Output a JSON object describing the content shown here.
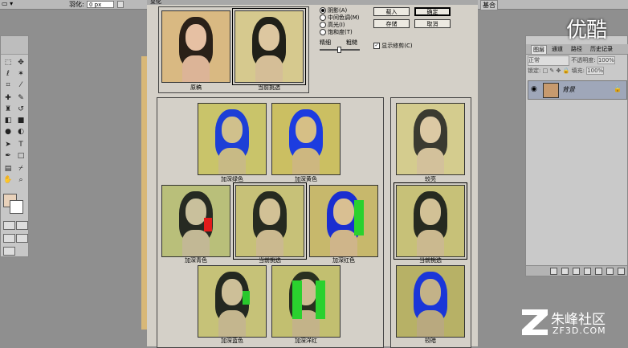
{
  "option_bar": {
    "feather_label": "羽化:",
    "feather_value": "0 px"
  },
  "dialog": {
    "title": "变化",
    "original_caption": "原稿",
    "current_caption_top": "当前挑选",
    "radios": [
      {
        "label": "阴影(A)",
        "selected": true
      },
      {
        "label": "中间色调(M)",
        "selected": false
      },
      {
        "label": "高光(I)",
        "selected": false
      },
      {
        "label": "饱和度(T)",
        "selected": false
      }
    ],
    "fine_label": "精细",
    "coarse_label": "粗糙",
    "buttons": {
      "load": "载入",
      "ok": "确定",
      "save": "存储",
      "cancel": "取消"
    },
    "show_clipping_label": "显示修剪(C)",
    "show_clipping_checked": true,
    "grid_captions": [
      "加深绿色",
      "加深黄色",
      "加深青色",
      "当前挑选",
      "加深红色",
      "加深蓝色",
      "加深洋红"
    ],
    "brightness_captions": [
      "较亮",
      "当前挑选",
      "较暗"
    ]
  },
  "tab_title_right": "基合",
  "layers_panel": {
    "tabs": [
      "图层",
      "通道",
      "路径",
      "历史记录"
    ],
    "blend_mode": "正常",
    "opacity_label": "不透明度:",
    "opacity_value": "100%",
    "lock_label": "锁定:",
    "fill_label": "填充:",
    "fill_value": "100%",
    "layer_name": "背景"
  },
  "watermark_top": "优酷",
  "watermark_brand": "朱峰社区",
  "watermark_site": "ZF3D.COM"
}
